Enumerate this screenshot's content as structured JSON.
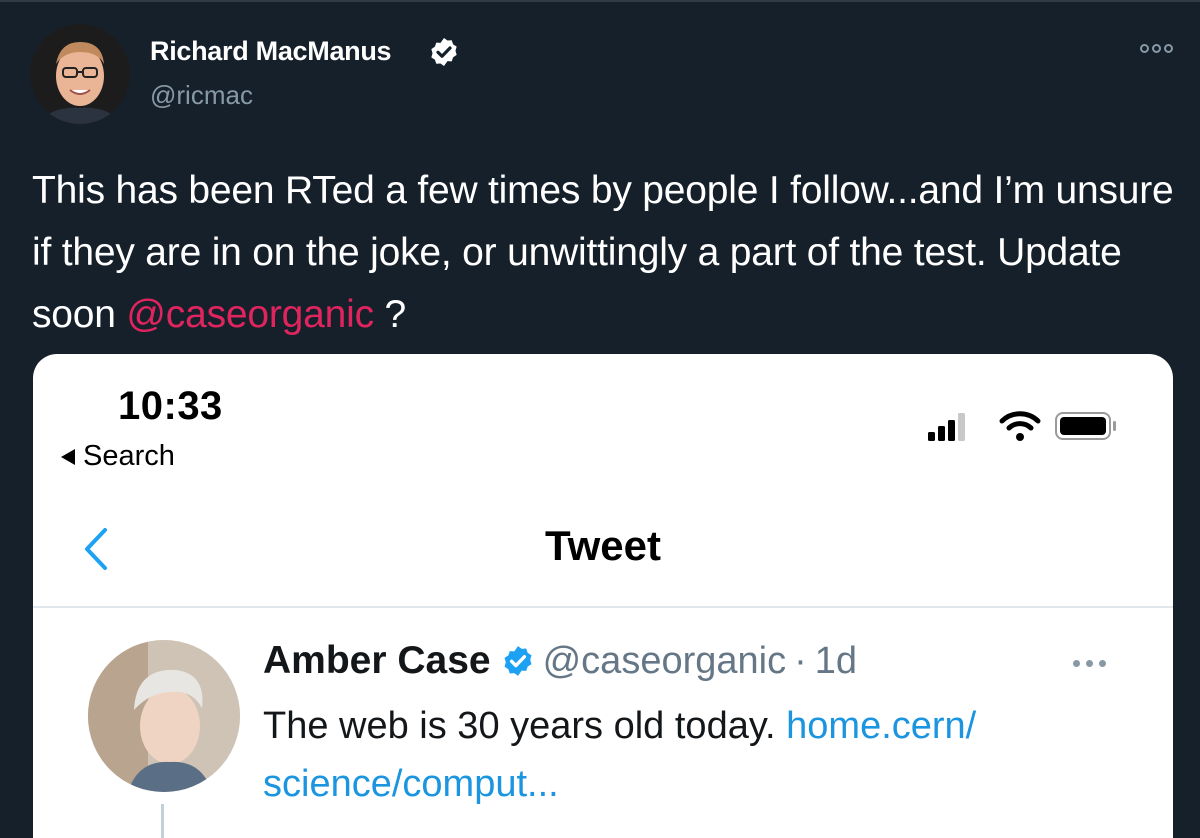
{
  "tweet": {
    "author_name": "Richard MacManus",
    "author_handle": "@ricmac",
    "text_part1": "This has been RTed a few times by people I follow...and I’m unsure if they are in on the joke, or unwittingly a part of the test. Update soon ",
    "mention": "@caseorganic",
    "text_part2": " ?"
  },
  "embedded": {
    "status_time": "10:33",
    "back_label": "Search",
    "nav_title": "Tweet",
    "author_name": "Amber Case",
    "author_handle": "@caseorganic",
    "separator": "·",
    "age": "1d",
    "text": "The web is 30 years old today. ",
    "link": "home.cern/ science/comput..."
  },
  "colors": {
    "background": "#15202b",
    "mention": "#e0245e",
    "verified": "#1da1f2",
    "link": "#1b95e0"
  },
  "icons": [
    "verified-badge-icon",
    "more-options-icon",
    "back-chevron-icon",
    "signal-icon",
    "wifi-icon",
    "battery-icon"
  ]
}
